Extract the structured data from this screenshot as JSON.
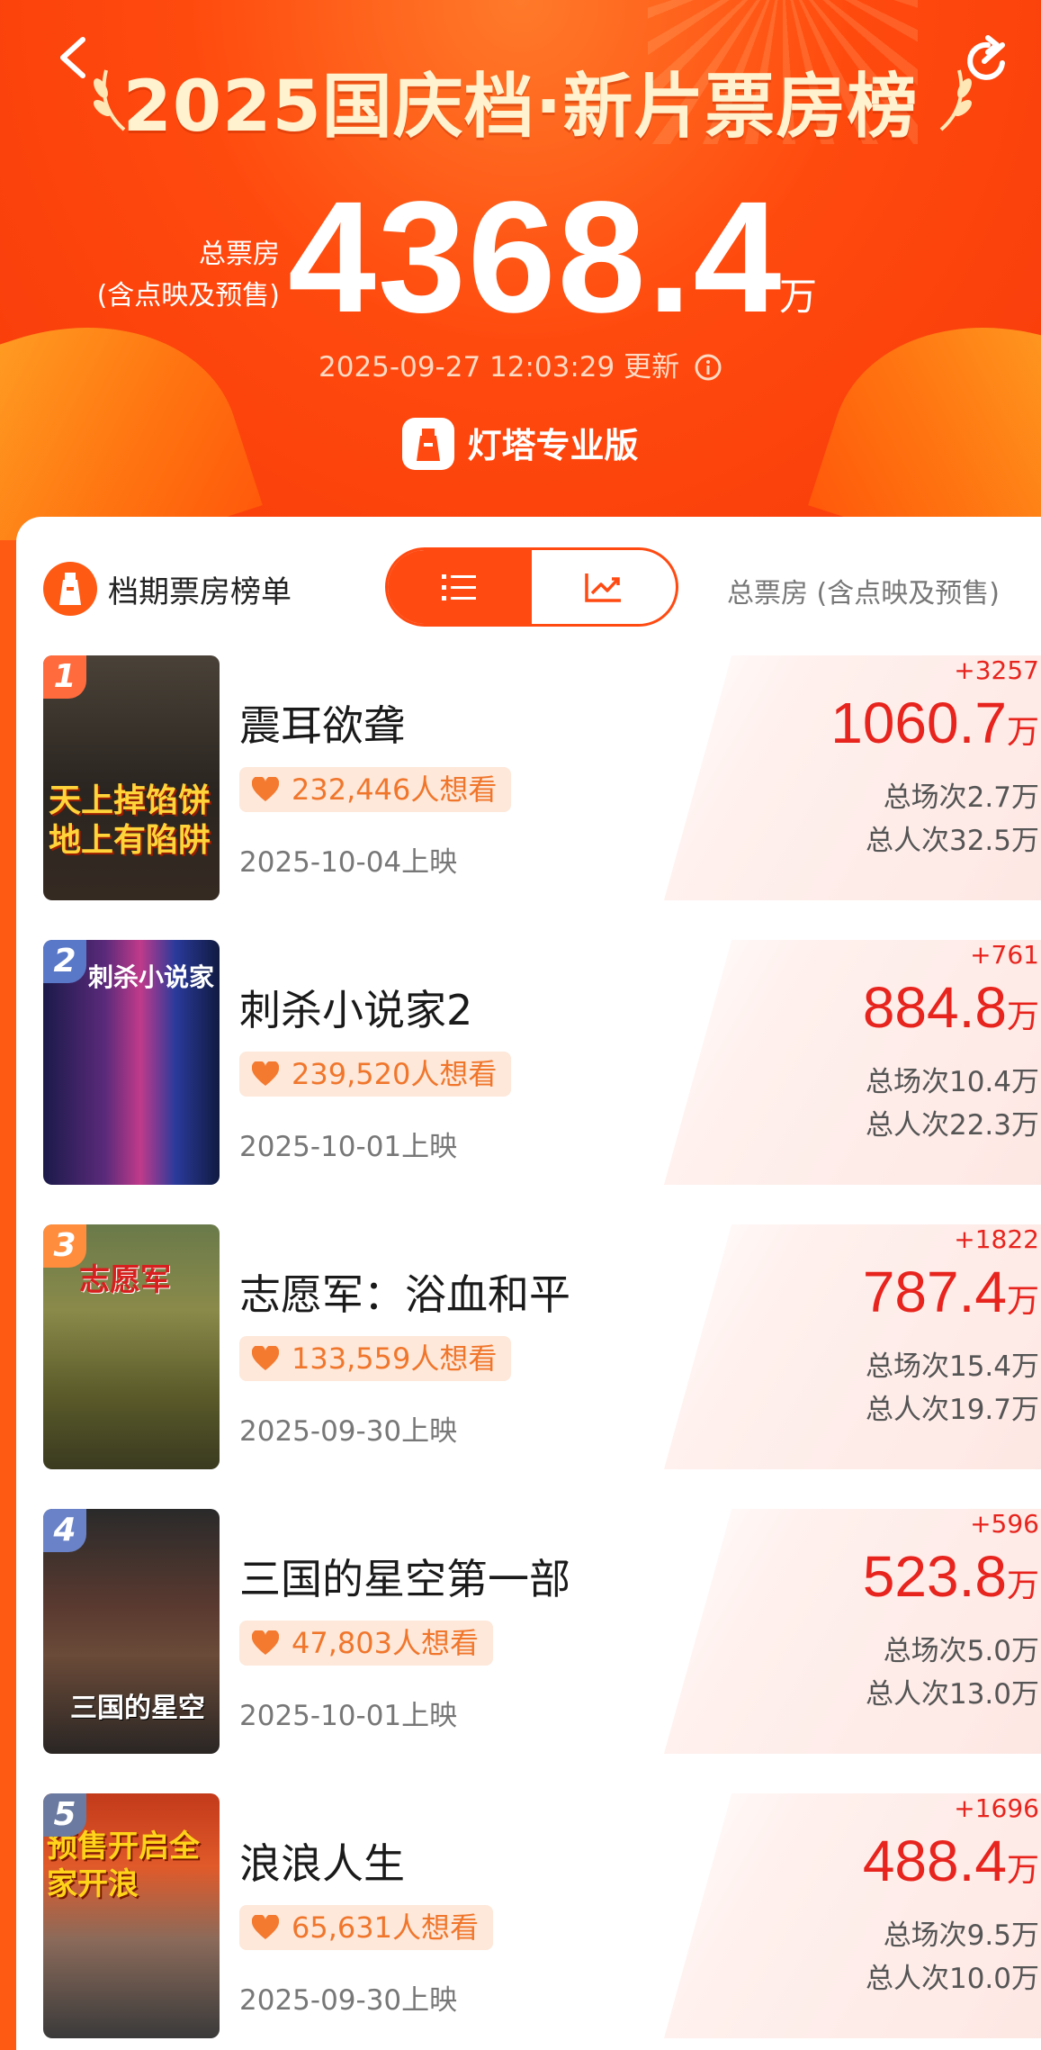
{
  "header": {
    "title": "2025国庆档·新片票房榜",
    "total_label_line1": "总票房",
    "total_label_line2": "(含点映及预售)",
    "total_value": "4368.4",
    "total_unit": "万",
    "update_text": "2025-09-27 12:03:29 更新",
    "brand": "灯塔专业版"
  },
  "panel": {
    "title": "档期票房榜单",
    "right_label": "总票房 (含点映及预售)",
    "toggle": [
      "list",
      "chart"
    ]
  },
  "movies": [
    {
      "rank": "1",
      "title": "震耳欲聋",
      "want": "232,446人想看",
      "release": "2025-10-04上映",
      "delta": "+3257",
      "gross": "1060.7",
      "unit": "万",
      "shows": "总场次2.7万",
      "viewers": "总人次32.5万",
      "poster_text": "天上掉馅饼地上有陷阱"
    },
    {
      "rank": "2",
      "title": "刺杀小说家2",
      "want": "239,520人想看",
      "release": "2025-10-01上映",
      "delta": "+761",
      "gross": "884.8",
      "unit": "万",
      "shows": "总场次10.4万",
      "viewers": "总人次22.3万",
      "poster_text": "刺杀小说家"
    },
    {
      "rank": "3",
      "title": "志愿军：浴血和平",
      "want": "133,559人想看",
      "release": "2025-09-30上映",
      "delta": "+1822",
      "gross": "787.4",
      "unit": "万",
      "shows": "总场次15.4万",
      "viewers": "总人次19.7万",
      "poster_text": "志愿军"
    },
    {
      "rank": "4",
      "title": "三国的星空第一部",
      "want": "47,803人想看",
      "release": "2025-10-01上映",
      "delta": "+596",
      "gross": "523.8",
      "unit": "万",
      "shows": "总场次5.0万",
      "viewers": "总人次13.0万",
      "poster_text": "三国的星空"
    },
    {
      "rank": "5",
      "title": "浪浪人生",
      "want": "65,631人想看",
      "release": "2025-09-30上映",
      "delta": "+1696",
      "gross": "488.4",
      "unit": "万",
      "shows": "总场次9.5万",
      "viewers": "总人次10.0万",
      "poster_text": "预售开启全家开浪"
    }
  ],
  "colors": {
    "accent": "#ff4a12",
    "gross_red": "#e7241d",
    "want_orange": "#f0762c"
  }
}
